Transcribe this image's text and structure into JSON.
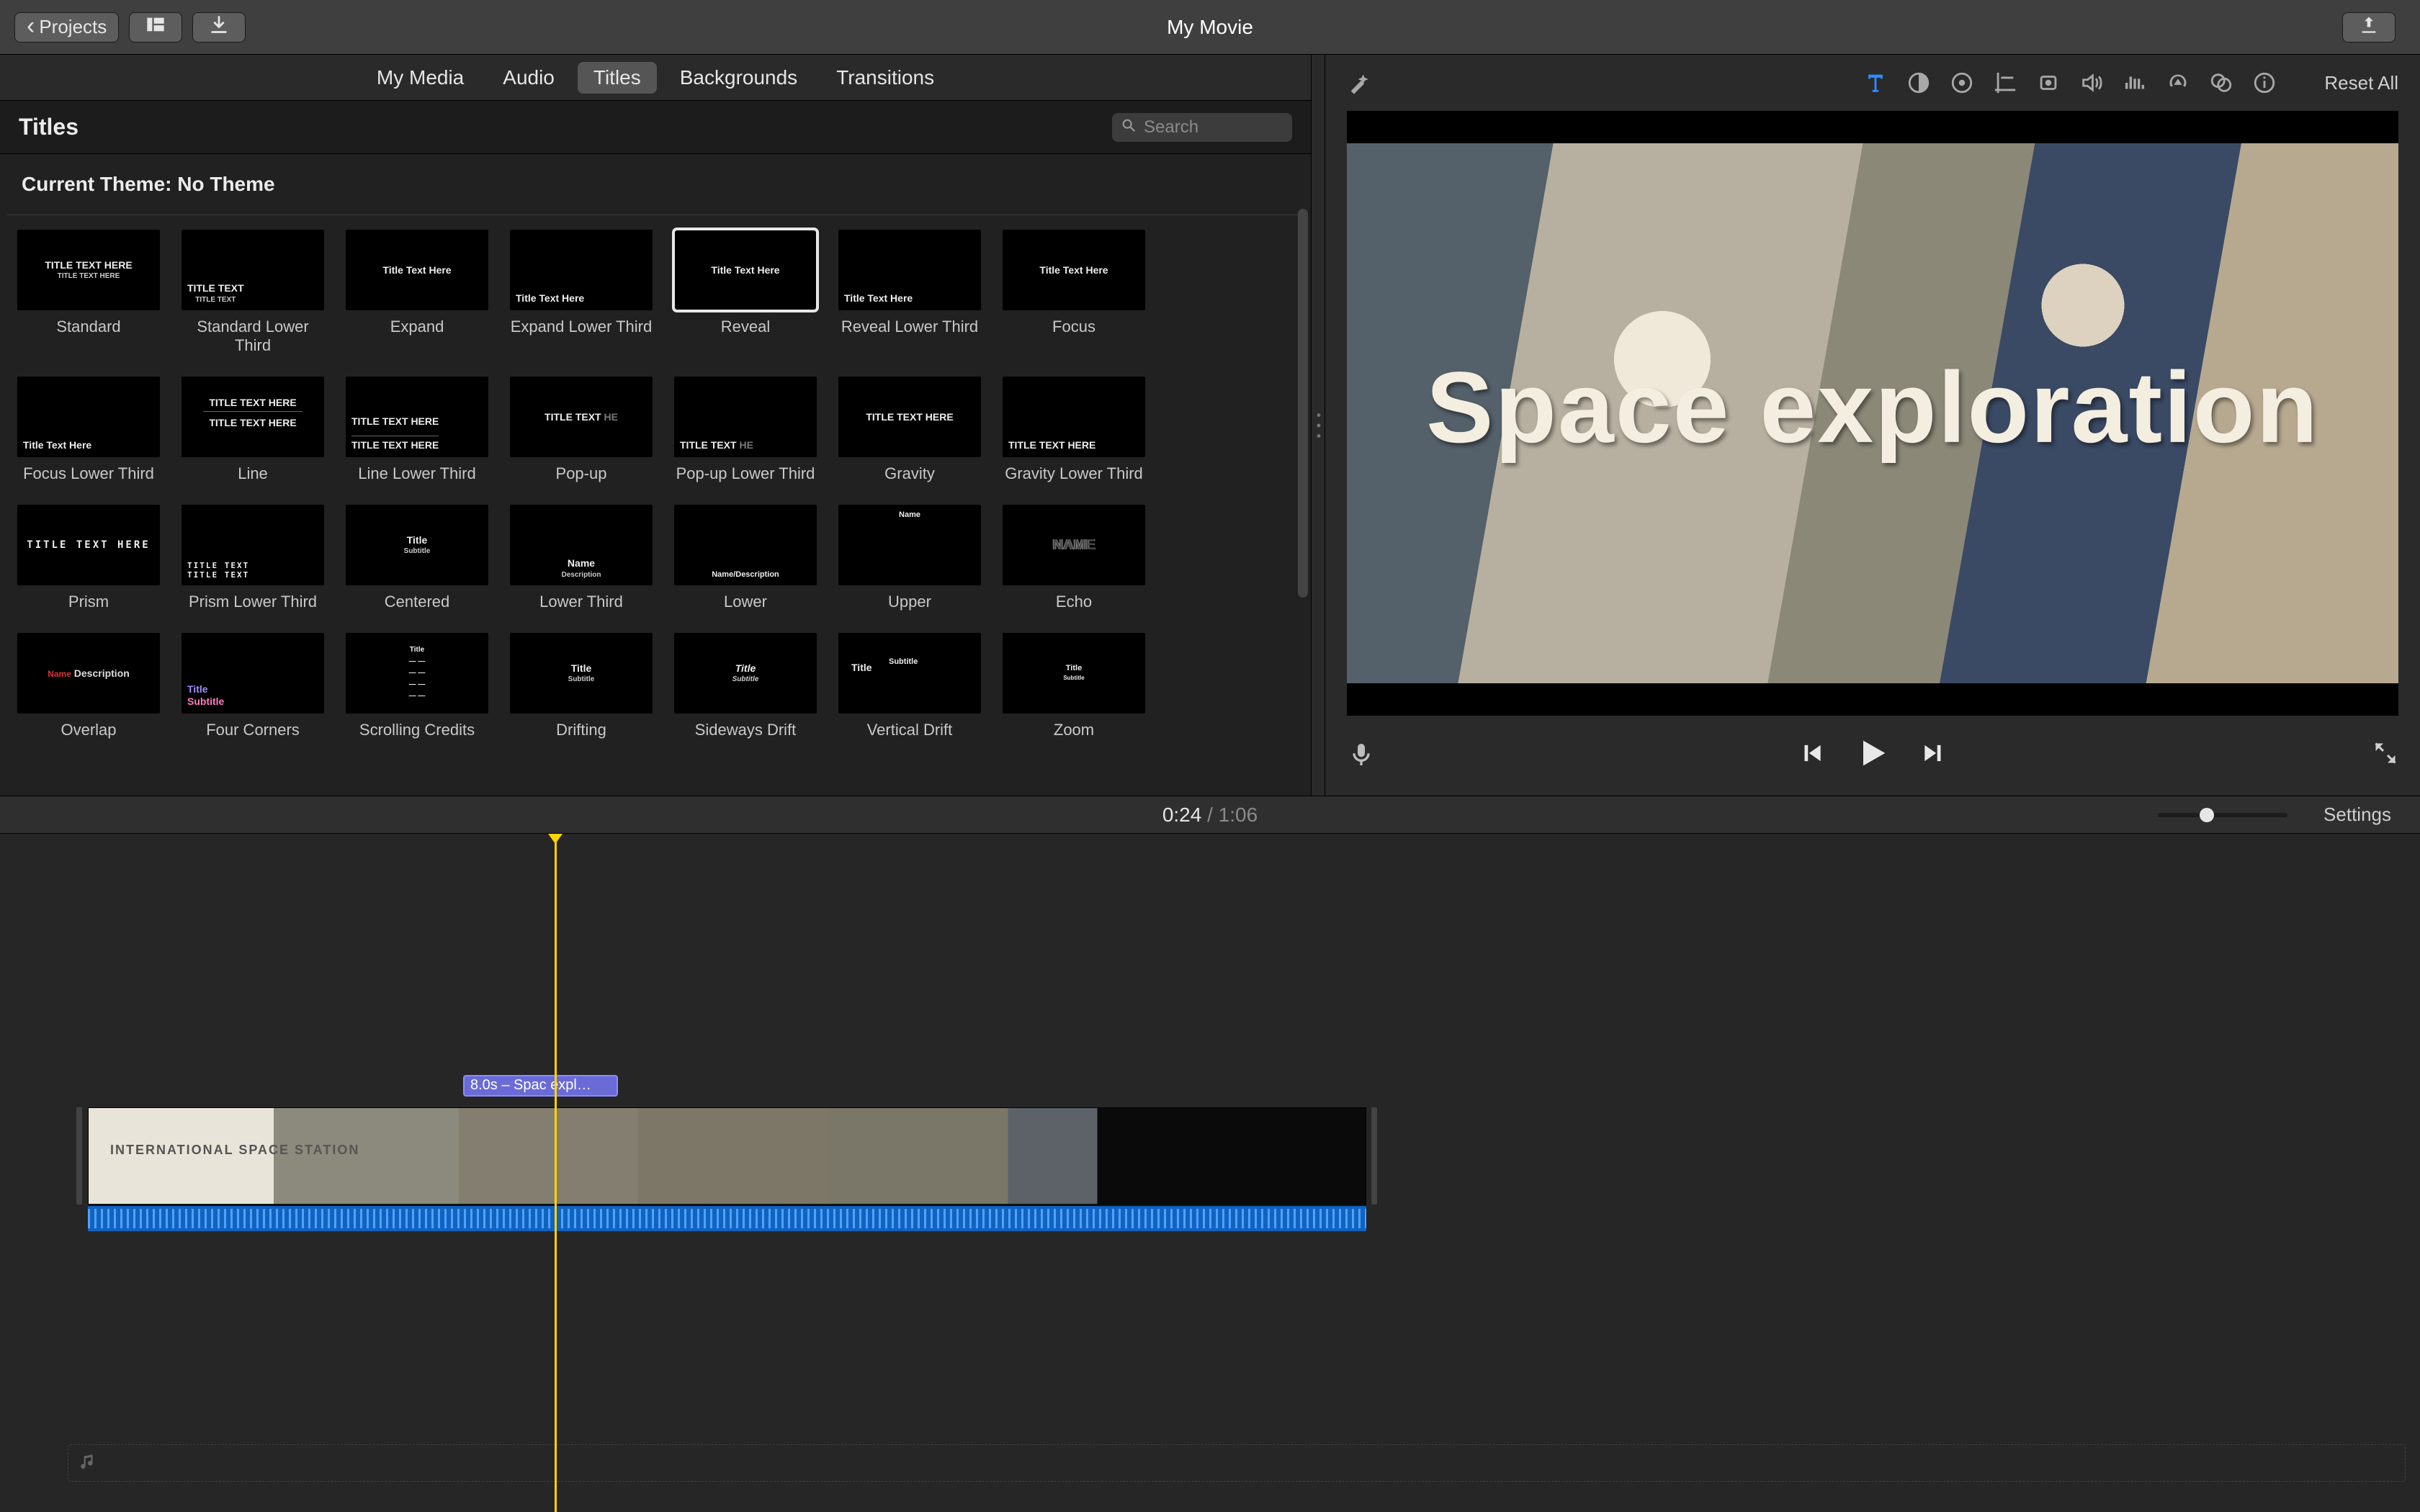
{
  "titlebar": {
    "projects_label": "Projects",
    "movie_title": "My Movie"
  },
  "library": {
    "tabs": [
      "My Media",
      "Audio",
      "Titles",
      "Backgrounds",
      "Transitions"
    ],
    "active_tab_index": 2,
    "section_title": "Titles",
    "search_placeholder": "Search",
    "theme_line": "Current Theme: No Theme",
    "titles": [
      "Standard",
      "Standard Lower Third",
      "Expand",
      "Expand Lower Third",
      "Reveal",
      "Reveal Lower Third",
      "Focus",
      "Focus Lower Third",
      "Line",
      "Line Lower Third",
      "Pop-up",
      "Pop-up Lower Third",
      "Gravity",
      "Gravity Lower Third",
      "Prism",
      "Prism Lower Third",
      "Centered",
      "Lower Third",
      "Lower",
      "Upper",
      "Echo",
      "Overlap",
      "Four Corners",
      "Scrolling Credits",
      "Drifting",
      "Sideways Drift",
      "Vertical Drift",
      "Zoom"
    ],
    "selected_title_index": 4
  },
  "viewer": {
    "reset_label": "Reset All",
    "preview_title_text": "Space exploration"
  },
  "timeline": {
    "current_time": "0:24",
    "duration": "1:06",
    "settings_label": "Settings",
    "title_clip_label": "8.0s – Spac   expl…"
  }
}
